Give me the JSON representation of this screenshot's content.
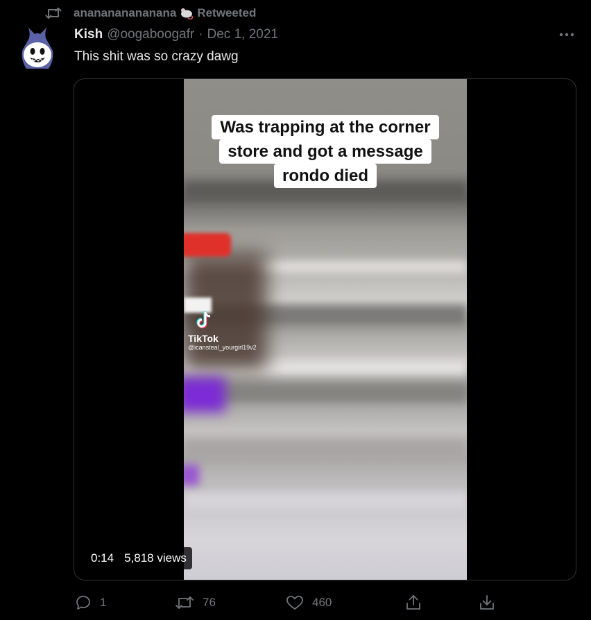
{
  "retweet": {
    "retweeter": "ananananananana",
    "label": "Retweeted",
    "icon": "retweet-icon",
    "emoji_icon": "mouse-icon"
  },
  "tweet": {
    "author_name": "Kish",
    "handle": "@oogaboogafr",
    "separator": "·",
    "date": "Dec 1, 2021",
    "text": "This shit was so crazy dawg",
    "more_icon": "more-icon"
  },
  "media": {
    "caption_lines": [
      "Was trapping at the corner",
      "store and got a message",
      "rondo died"
    ],
    "watermark": {
      "brand": "TikTok",
      "username": "@icansteal_yourgirl19v2"
    },
    "duration": "0:14",
    "views": "5,818 views"
  },
  "actions": {
    "reply": {
      "icon": "reply-icon",
      "count": "1"
    },
    "retweet": {
      "icon": "retweet-icon",
      "count": "76"
    },
    "like": {
      "icon": "heart-icon",
      "count": "460"
    },
    "share": {
      "icon": "share-icon"
    },
    "download": {
      "icon": "download-icon"
    }
  },
  "colors": {
    "background": "#000000",
    "primary_text": "#e7e9ea",
    "secondary_text": "#71767b",
    "border": "#2f3336"
  }
}
